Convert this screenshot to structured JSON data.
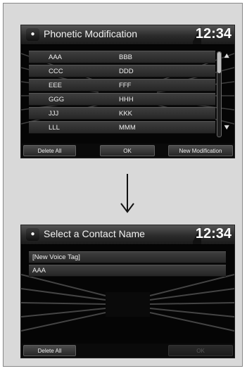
{
  "screen1": {
    "title": "Phonetic Modification",
    "clock": "12:34",
    "back_icon": "dot-icon",
    "rows": [
      {
        "name": "AAA",
        "value": "BBB"
      },
      {
        "name": "CCC",
        "value": "DDD"
      },
      {
        "name": "EEE",
        "value": "FFF"
      },
      {
        "name": "GGG",
        "value": "HHH"
      },
      {
        "name": "JJJ",
        "value": "KKK"
      },
      {
        "name": "LLL",
        "value": "MMM"
      }
    ],
    "scroll_up_icon": "double-chevron-up-icon",
    "scroll_down_icon": "double-chevron-down-icon",
    "scroll_position": 0,
    "buttons": {
      "delete_all": "Delete All",
      "ok": "OK",
      "new_modification": "New Modification"
    }
  },
  "transition_icon": "arrow-down-icon",
  "screen2": {
    "title": "Select a Contact Name",
    "clock": "12:34",
    "back_icon": "dot-icon",
    "rows": [
      {
        "name": "[New Voice Tag]"
      },
      {
        "name": "AAA"
      }
    ],
    "buttons": {
      "delete_all": "Delete All",
      "ok": "OK"
    }
  }
}
